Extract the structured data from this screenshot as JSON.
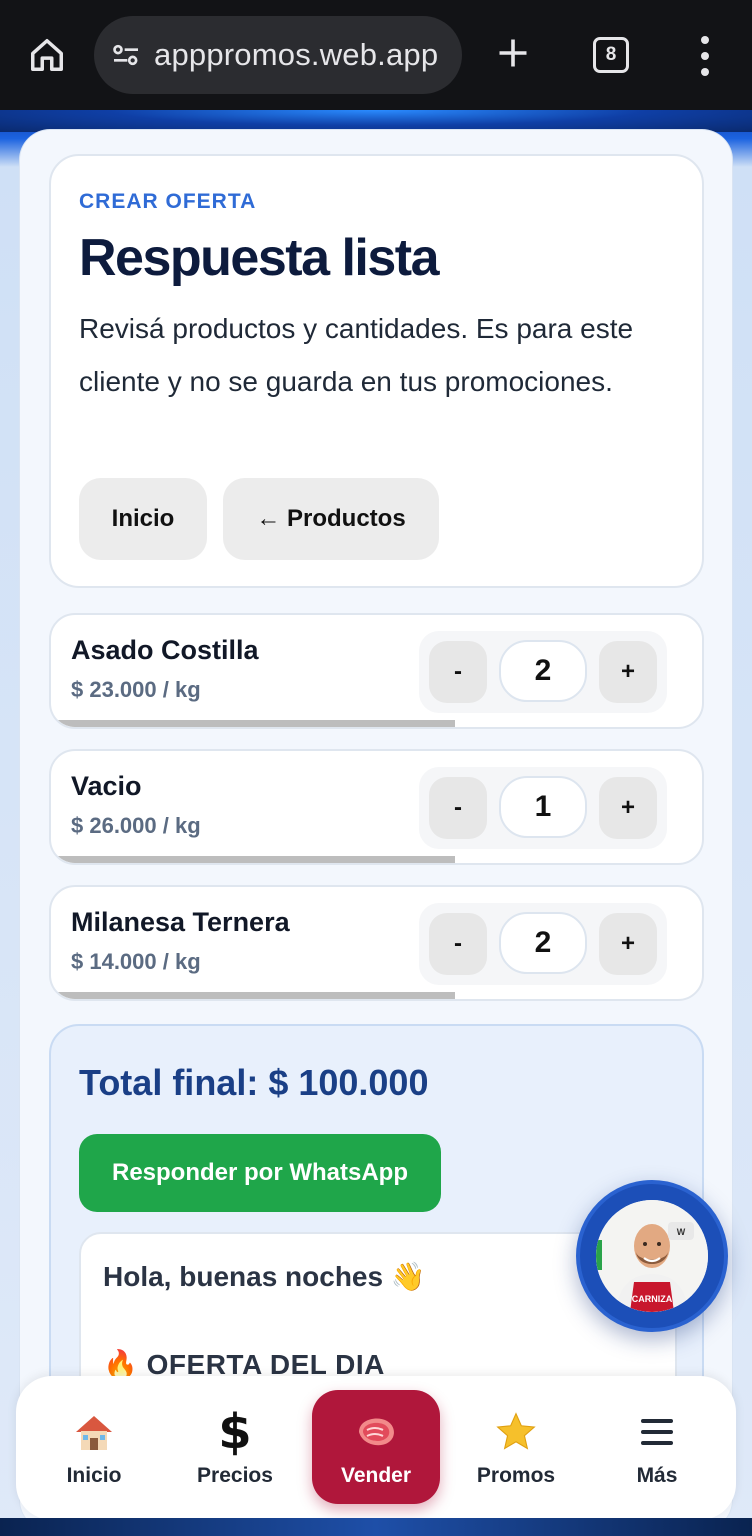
{
  "browser": {
    "url": "apppromos.web.app",
    "tab_count": "8"
  },
  "header": {
    "eyebrow": "CREAR OFERTA",
    "title": "Respuesta lista",
    "description": "Revisá productos y cantidades. Es para este cliente y no se guarda en tus promociones.",
    "btn_inicio": "Inicio",
    "btn_productos": "← Productos"
  },
  "products": [
    {
      "name": "Asado Costilla",
      "price": "$ 23.000 / kg",
      "qty": "2",
      "minus": "-",
      "plus": "+"
    },
    {
      "name": "Vacio",
      "price": "$ 26.000 / kg",
      "qty": "1",
      "minus": "-",
      "plus": "+"
    },
    {
      "name": "Milanesa Ternera",
      "price": "$ 14.000 / kg",
      "qty": "2",
      "minus": "-",
      "plus": "+"
    }
  ],
  "summary": {
    "total": "Total final: $ 100.000",
    "whatsapp_label": "Responder por WhatsApp",
    "message_greeting": "Hola, buenas noches 👋",
    "message_offer": "🔥 OFERTA DEL DIA"
  },
  "avatar": {
    "apron_text": "CARNIZA"
  },
  "nav": {
    "inicio": "Inicio",
    "precios": "Precios",
    "vender": "Vender",
    "promos": "Promos",
    "mas": "Más"
  },
  "colors": {
    "accent_blue": "#2f6bd6",
    "title_navy": "#0d1b3d",
    "whatsapp_green": "#1fa64a",
    "vender_red": "#b0173b"
  }
}
